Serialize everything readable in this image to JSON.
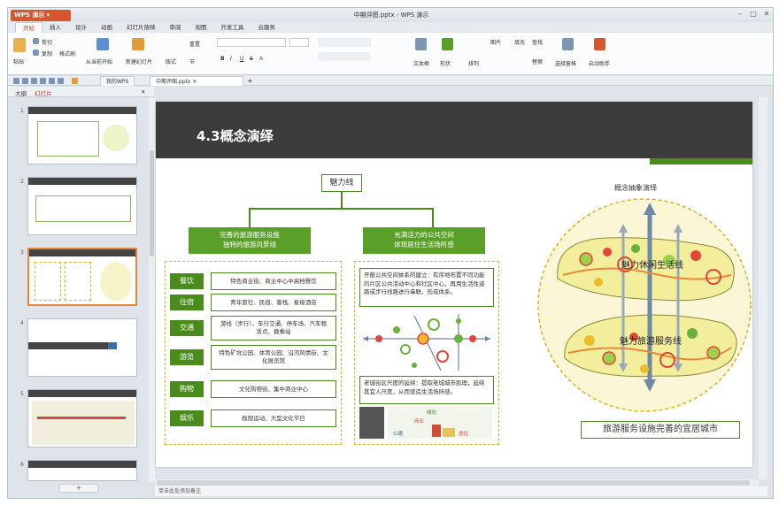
{
  "window": {
    "app_button": "WPS 演示",
    "title": "中期评图.pptx - WPS 演示"
  },
  "menu_tabs": [
    "开始",
    "插入",
    "设计",
    "动画",
    "幻灯片放映",
    "审阅",
    "视图",
    "开发工具",
    "云服务"
  ],
  "active_tab": "开始",
  "ribbon": {
    "paste": "粘贴",
    "cut": "剪切",
    "copy": "复制",
    "format_painter": "格式刷",
    "from_current": "从当前开始",
    "new_slide": "新建幻灯片",
    "layout": "版式",
    "reset": "重置",
    "section": "节",
    "font_bold": "B",
    "font_italic": "I",
    "font_underline": "U",
    "font_strike": "S",
    "font_color": "A",
    "textbox": "文本框",
    "shape": "形状",
    "arrange": "排列",
    "picture": "图片",
    "fill": "填充",
    "find": "查找",
    "replace": "替换",
    "select_pane": "选择窗格",
    "helper": "启动助手"
  },
  "doc_tabs": [
    "我的WPS",
    "中期评图.pptx"
  ],
  "pane_tabs": [
    "大纲",
    "幻灯片"
  ],
  "thumb_numbers": [
    "1",
    "2",
    "3",
    "4",
    "5",
    "6"
  ],
  "notes_placeholder": "单击此处添加备注",
  "add_slide": "+",
  "slide": {
    "title": "4.3概念演绎",
    "root": "魅力线",
    "branch_left": [
      "完善的旅游服务设施",
      "独特的旅游风景线"
    ],
    "branch_right": [
      "充满活力的公共空间",
      "体现居住生活场所感"
    ],
    "rows": [
      {
        "label": "餐饮",
        "text": "特色商业街、商业中心中高档餐饮"
      },
      {
        "label": "住宿",
        "text": "青年旅社、民宿、客栈、星级酒店"
      },
      {
        "label": "交通",
        "text": "游线（步行）、车行交通、停车场、汽车租赁点、换乘站"
      },
      {
        "label": "游览",
        "text": "特色矿坑公园、体育公园、沿河风情街、文化展览馆"
      },
      {
        "label": "购物",
        "text": "文化购物街、集中商业中心"
      },
      {
        "label": "娱乐",
        "text": "极限运动、大型文化节日"
      }
    ],
    "para1": "开敞公共空间体系的建立：有序地布置不同功能的片区公共活动中心和社区中心，再用生活性道路或步行线路进行串联，形成体系。",
    "para2": "老城街区尺度的延续：提取老城城市肌理，延续其宜人尺度，从而营造生活场所感。",
    "map_labels": [
      "绿化",
      "商业",
      "公建",
      "居住"
    ],
    "abstract_title": "概念抽象演绎",
    "ellipse_top": "魅力休闲生活线",
    "ellipse_bottom": "魅力旅游服务线",
    "caption": "旅游服务设施完善的宜居城市"
  },
  "colors": {
    "accent_green": "#4a8c1c",
    "header_dark": "#3c3c3c",
    "wps_red": "#d8562b",
    "dash_yellow": "#e0b21a"
  }
}
